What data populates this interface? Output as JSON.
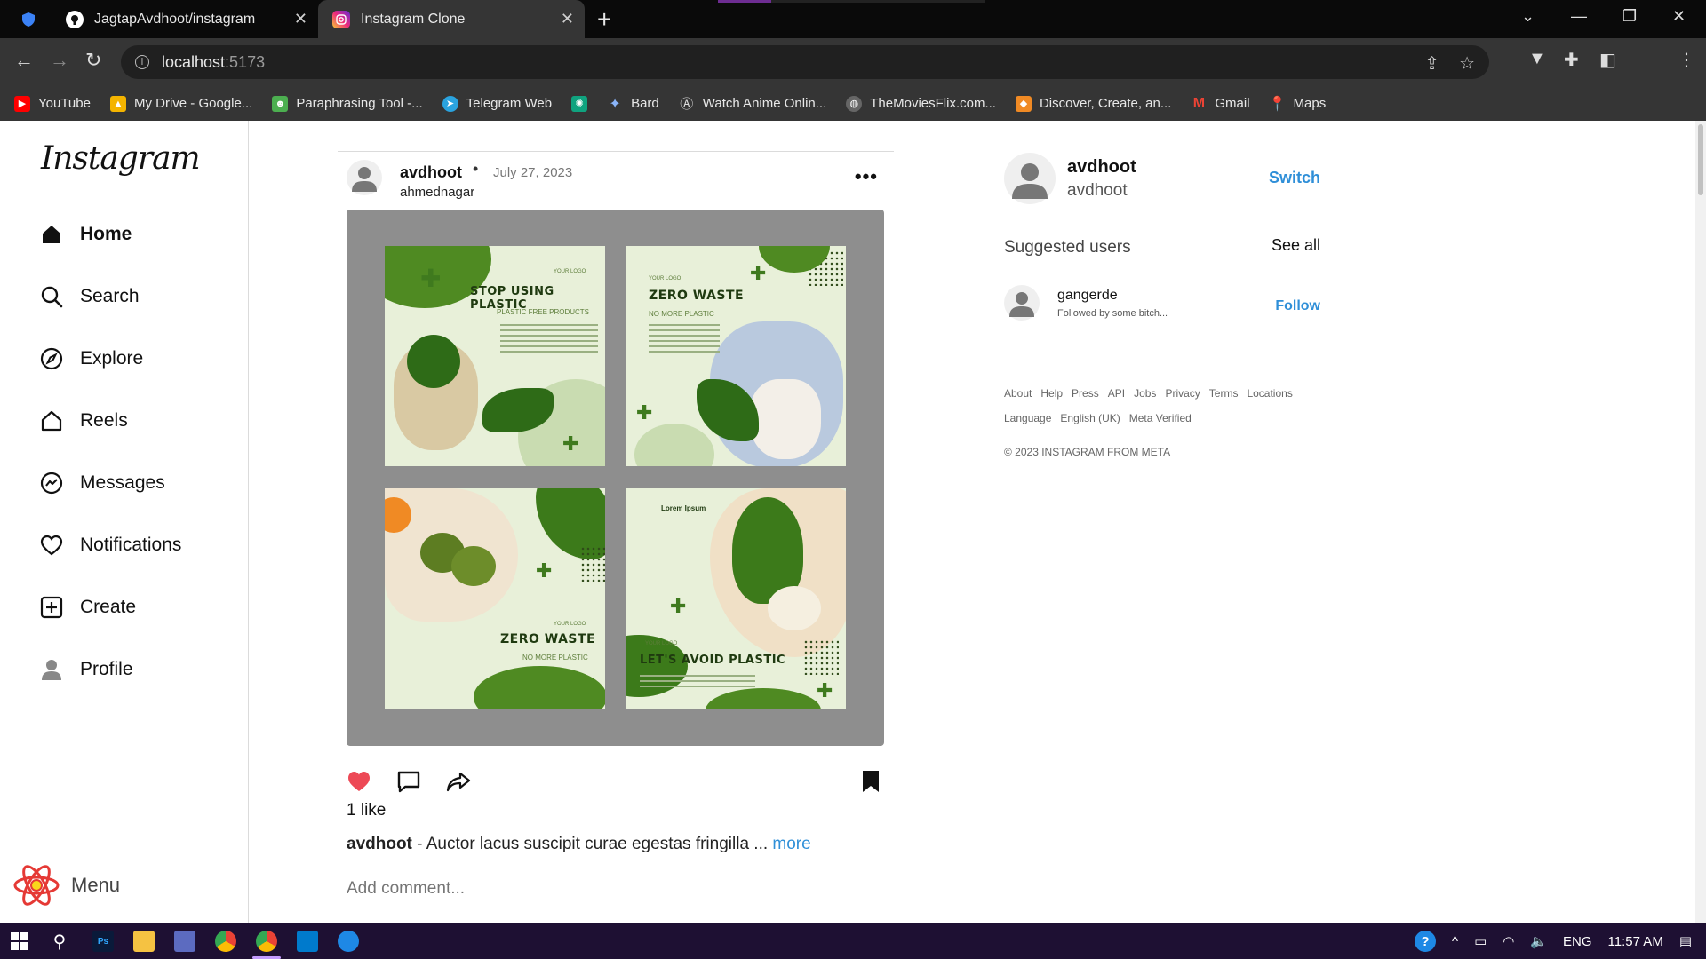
{
  "browser": {
    "tabs": [
      {
        "title": "",
        "icon": "shield-icon"
      },
      {
        "title": "JagtapAvdhoot/instagram",
        "icon": "github-icon"
      },
      {
        "title": "Instagram Clone",
        "icon": "instagram-icon"
      }
    ],
    "url_host": "localhost",
    "url_port": ":5173",
    "bookmarks": [
      {
        "label": "YouTube",
        "color": "#ff0000"
      },
      {
        "label": "My Drive - Google...",
        "color": "#f4b400"
      },
      {
        "label": "Paraphrasing Tool -...",
        "color": "#4caf50"
      },
      {
        "label": "Telegram Web",
        "color": "#2aa3df"
      },
      {
        "label": "",
        "color": "#10a37f"
      },
      {
        "label": "Bard",
        "color": "#4285f4"
      },
      {
        "label": "Watch Anime Onlin...",
        "color": "#888888"
      },
      {
        "label": "TheMoviesFlix.com...",
        "color": "#666666"
      },
      {
        "label": "Discover, Create, an...",
        "color": "#f08a24"
      },
      {
        "label": "Gmail",
        "color": "#ea4335"
      },
      {
        "label": "Maps",
        "color": "#34a853"
      }
    ]
  },
  "sidebar": {
    "logo": "Instagram",
    "items": [
      {
        "label": "Home",
        "icon": "home-icon"
      },
      {
        "label": "Search",
        "icon": "search-icon"
      },
      {
        "label": "Explore",
        "icon": "compass-icon"
      },
      {
        "label": "Reels",
        "icon": "reels-icon"
      },
      {
        "label": "Messages",
        "icon": "messenger-icon"
      },
      {
        "label": "Notifications",
        "icon": "heart-icon"
      },
      {
        "label": "Create",
        "icon": "plus-square-icon"
      },
      {
        "label": "Profile",
        "icon": "user-icon"
      }
    ],
    "menu_label": "Menu"
  },
  "post": {
    "username": "avdhoot",
    "separator": "•",
    "date": "July 27, 2023",
    "location": "ahmednagar",
    "more_dots": "•••",
    "image_tiles": [
      {
        "title": "STOP USING PLASTIC",
        "subtitle": "PLASTIC FREE PRODUCTS",
        "logo": "YOUR LOGO"
      },
      {
        "title": "ZERO WASTE",
        "subtitle": "NO MORE PLASTIC",
        "logo": "YOUR LOGO"
      },
      {
        "title": "ZERO WASTE",
        "subtitle": "NO MORE PLASTIC",
        "logo": "YOUR LOGO"
      },
      {
        "title": "LET'S AVOID PLASTIC",
        "subtitle": "Lorem Ipsum",
        "logo": "YOUR LOGO"
      }
    ],
    "likes": "1 like",
    "caption_user": "avdhoot",
    "caption_text": " - Auctor lacus suscipit curae egestas fringilla ... ",
    "caption_more": "more",
    "comment_placeholder": "Add comment...",
    "accent_like": "#ed4956"
  },
  "right_panel": {
    "username": "avdhoot",
    "name": "avdhoot",
    "switch_label": "Switch",
    "suggested_title": "Suggested users",
    "see_all": "See all",
    "suggested": [
      {
        "username": "gangerde",
        "subtitle": "Followed by some bitch...",
        "follow_label": "Follow"
      }
    ],
    "footer_row1": [
      "About",
      "Help",
      "Press",
      "API",
      "Jobs",
      "Privacy",
      "Terms",
      "Locations"
    ],
    "footer_row2": [
      "Language",
      "English (UK)",
      "Meta Verified"
    ],
    "copyright": "© 2023 INSTAGRAM FROM META",
    "link_color": "#2f8fd8"
  },
  "taskbar": {
    "language": "ENG",
    "time": "11:57 AM"
  }
}
